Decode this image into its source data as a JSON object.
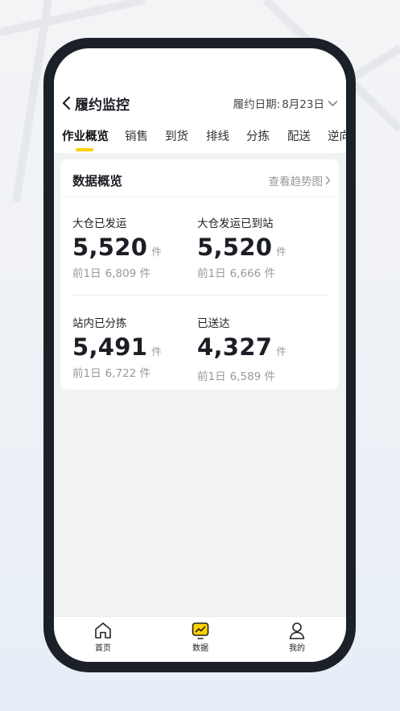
{
  "header": {
    "title": "履约监控",
    "date_label": "履约日期:",
    "date_value": "8月23日"
  },
  "tabs": [
    {
      "label": "作业概览",
      "active": true
    },
    {
      "label": "销售"
    },
    {
      "label": "到货"
    },
    {
      "label": "排线"
    },
    {
      "label": "分拣"
    },
    {
      "label": "配送"
    },
    {
      "label": "逆向"
    }
  ],
  "overview": {
    "title": "数据概览",
    "trend_link": "查看趋势图",
    "metrics": [
      {
        "label": "大仓已发运",
        "value": "5,520",
        "unit": "件",
        "prev_label": "前1日",
        "prev_value": "6,809 件"
      },
      {
        "label": "大仓发运已到站",
        "value": "5,520",
        "unit": "件",
        "prev_label": "前1日",
        "prev_value": "6,666 件"
      },
      {
        "label": "站内已分拣",
        "value": "5,491",
        "unit": "件",
        "prev_label": "前1日",
        "prev_value": "6,722 件"
      },
      {
        "label": "已送达",
        "value": "4,327",
        "unit": "件",
        "prev_label": "前1日",
        "prev_value": "6,589 件"
      }
    ]
  },
  "bottom_nav": [
    {
      "label": "首页",
      "icon": "home-icon"
    },
    {
      "label": "数据",
      "icon": "chart-icon",
      "active": true
    },
    {
      "label": "我的",
      "icon": "user-icon"
    }
  ],
  "colors": {
    "accent": "#ffd100",
    "phone_frame": "#1b2029",
    "screen_bg": "#f1f2f4",
    "muted_text": "#999999"
  }
}
